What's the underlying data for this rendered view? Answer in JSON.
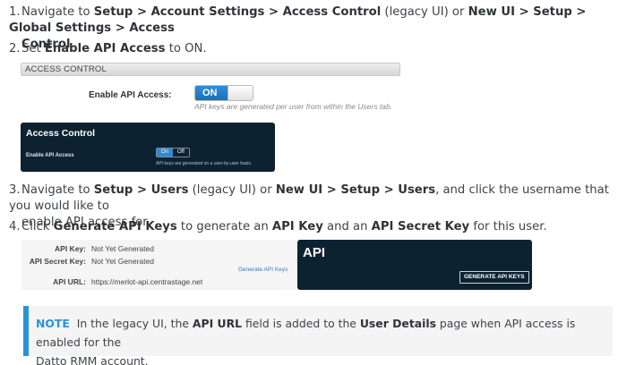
{
  "steps": [
    {
      "number": "1.",
      "parts": [
        "Navigate to ",
        "Setup > Account Settings > Access Control",
        " (legacy UI) or ",
        "New UI > Setup > Global Settings > Access",
        "Control",
        "."
      ]
    },
    {
      "number": "2.",
      "parts": [
        "Set ",
        "Enable API Access",
        " to ON."
      ]
    },
    {
      "number": "3.",
      "parts": [
        "Navigate to ",
        "Setup > Users",
        " (legacy UI) or ",
        "New UI > Setup > Users",
        ", and click the username that you would like to",
        "enable API access for."
      ]
    },
    {
      "number": "4.",
      "parts": [
        "Click ",
        "Generate API Keys",
        " to generate an ",
        "API Key",
        " and an ",
        "API Secret Key",
        " for this user."
      ]
    }
  ],
  "legacy_access": {
    "header": "ACCESS CONTROL",
    "label": "Enable API Access:",
    "toggle_on": "ON",
    "hint": "API keys are generated per user from within the Users tab."
  },
  "new_access": {
    "title": "Access Control",
    "label": "Enable API Access",
    "on": "On",
    "off": "Off",
    "hint": "API keys are generated on a user-by-user basis."
  },
  "legacy_keys": {
    "api_key_label": "API Key:",
    "api_key_value": "Not Yet Generated",
    "secret_label": "API Secret Key:",
    "secret_value": "Not Yet Generated",
    "generate_link": "Generate API Keys",
    "url_label": "API URL:",
    "url_value": "https://merlot-api.centrastage.net"
  },
  "new_keys": {
    "title": "API",
    "button": "GENERATE API KEYS"
  },
  "note": {
    "tag": "NOTE",
    "parts": [
      "In the legacy UI, the ",
      "API URL",
      " field is added to the ",
      "User Details",
      " page when API access is enabled for the",
      "Datto RMM account."
    ]
  },
  "colors": {
    "accent": "#2a93d5",
    "dark_panel": "#0d2230",
    "toggle_on": "#1a6fb8"
  }
}
